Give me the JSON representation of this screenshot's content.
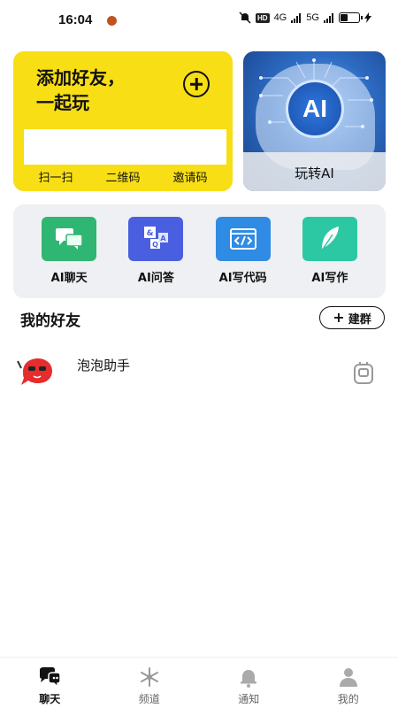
{
  "status_bar": {
    "time": "16:04",
    "hd_badge": "HD",
    "signal_1": "4G",
    "signal_2": "5G",
    "battery_level": 0.35
  },
  "add_friend_card": {
    "title": "添加好友，\n一起玩",
    "actions": [
      "扫一扫",
      "二维码",
      "邀请码"
    ],
    "background_color": "#f8de14"
  },
  "ai_card": {
    "logo_text": "AI",
    "label": "玩转AI"
  },
  "tools": [
    {
      "label": "AI聊天",
      "icon": "chat-bubbles-icon",
      "color": "#2fb673"
    },
    {
      "label": "AI问答",
      "icon": "qa-cube-icon",
      "color": "#4a5fe0"
    },
    {
      "label": "AI写代码",
      "icon": "code-window-icon",
      "color": "#2f8be3"
    },
    {
      "label": "AI写作",
      "icon": "feather-icon",
      "color": "#2cc7a3"
    }
  ],
  "friends": {
    "section_title": "我的好友",
    "create_group_label": "建群",
    "items": [
      {
        "name": "泡泡助手",
        "avatar": "red-bubble-avatar",
        "action_icon": "device-icon"
      }
    ]
  },
  "bottom_nav": {
    "items": [
      {
        "label": "聊天",
        "icon": "chat-icon",
        "active": true
      },
      {
        "label": "频道",
        "icon": "snowflake-icon",
        "active": false
      },
      {
        "label": "通知",
        "icon": "bell-icon",
        "active": false
      },
      {
        "label": "我的",
        "icon": "person-icon",
        "active": false
      }
    ]
  }
}
